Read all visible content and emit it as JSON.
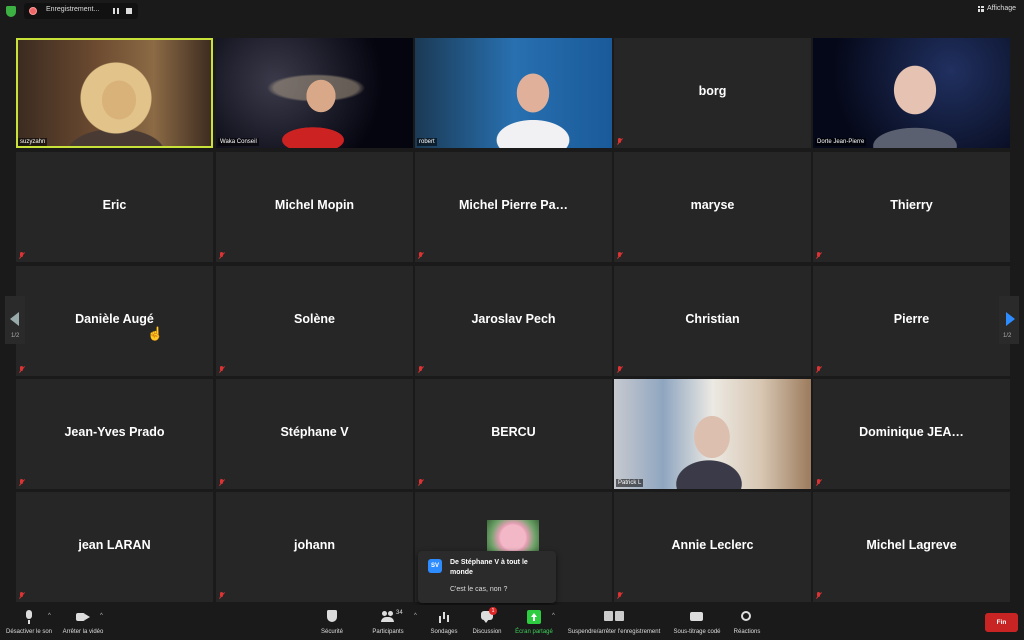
{
  "topbar": {
    "recording_label": "Enregistrement...",
    "view_label": "Affichage"
  },
  "tiles": [
    {
      "name": "",
      "label": "suzyzahn",
      "video": "suzy",
      "active": true
    },
    {
      "name": "",
      "label": "Waka Conseil",
      "video": "waka"
    },
    {
      "name": "",
      "label": "robert",
      "video": "robert"
    },
    {
      "name": "borg",
      "label": ""
    },
    {
      "name": "",
      "label": "Dorte Jean-Pierre",
      "video": "dorte"
    },
    {
      "name": "Eric",
      "label": ""
    },
    {
      "name": "Michel Mopin",
      "label": ""
    },
    {
      "name": "Michel Pierre Pa…",
      "label": ""
    },
    {
      "name": "maryse",
      "label": ""
    },
    {
      "name": "Thierry",
      "label": ""
    },
    {
      "name": "Danièle Augé",
      "label": ""
    },
    {
      "name": "Solène",
      "label": ""
    },
    {
      "name": "Jaroslav Pech",
      "label": ""
    },
    {
      "name": "Christian",
      "label": ""
    },
    {
      "name": "Pierre",
      "label": ""
    },
    {
      "name": "Jean-Yves Prado",
      "label": ""
    },
    {
      "name": "Stéphane V",
      "label": ""
    },
    {
      "name": "BERCU",
      "label": ""
    },
    {
      "name": "",
      "label": "Patrick L",
      "video": "patrick"
    },
    {
      "name": "Dominique  JEA…",
      "label": ""
    },
    {
      "name": "jean  LARAN",
      "label": ""
    },
    {
      "name": "johann",
      "label": ""
    },
    {
      "name": "",
      "label": "",
      "flower": true
    },
    {
      "name": "Annie Leclerc",
      "label": ""
    },
    {
      "name": "Michel Lagreve",
      "label": ""
    }
  ],
  "pagination": {
    "left": "1/2",
    "right": "1/2"
  },
  "chat_toast": {
    "avatar_initials": "SV",
    "from": "De Stéphane V à tout le monde",
    "message": "C'est le cas, non ?"
  },
  "toolbar": {
    "mute": "Désactiver le son",
    "video": "Arrêter la vidéo",
    "security": "Sécurité",
    "participants": "Participants",
    "participants_count": "34",
    "polls": "Sondages",
    "chat": "Discussion",
    "chat_badge": "1",
    "share": "Écran partagé",
    "recording": "Suspendre/arrêter l'enregistrement",
    "captions": "Sous-titrage codé",
    "reactions": "Réactions",
    "end": "Fin"
  }
}
